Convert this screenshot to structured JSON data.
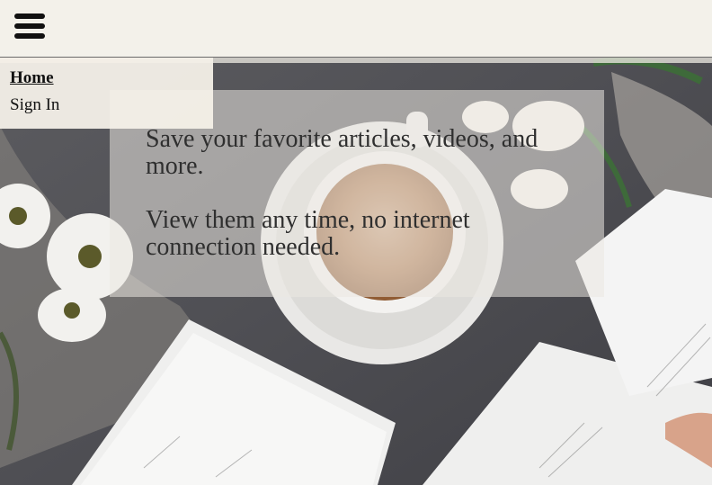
{
  "nav": {
    "menu_icon": "hamburger-menu-icon",
    "items": [
      {
        "label": "Home",
        "active": true
      },
      {
        "label": "Sign In",
        "active": false
      }
    ]
  },
  "hero": {
    "line1": "Save your favorite articles, videos, and more.",
    "line2": "View them any time, no internet connection needed."
  },
  "colors": {
    "topbar_bg": "#F6F4EE",
    "nav_bg": "#F4F0E8",
    "text": "#2F2F2F"
  }
}
